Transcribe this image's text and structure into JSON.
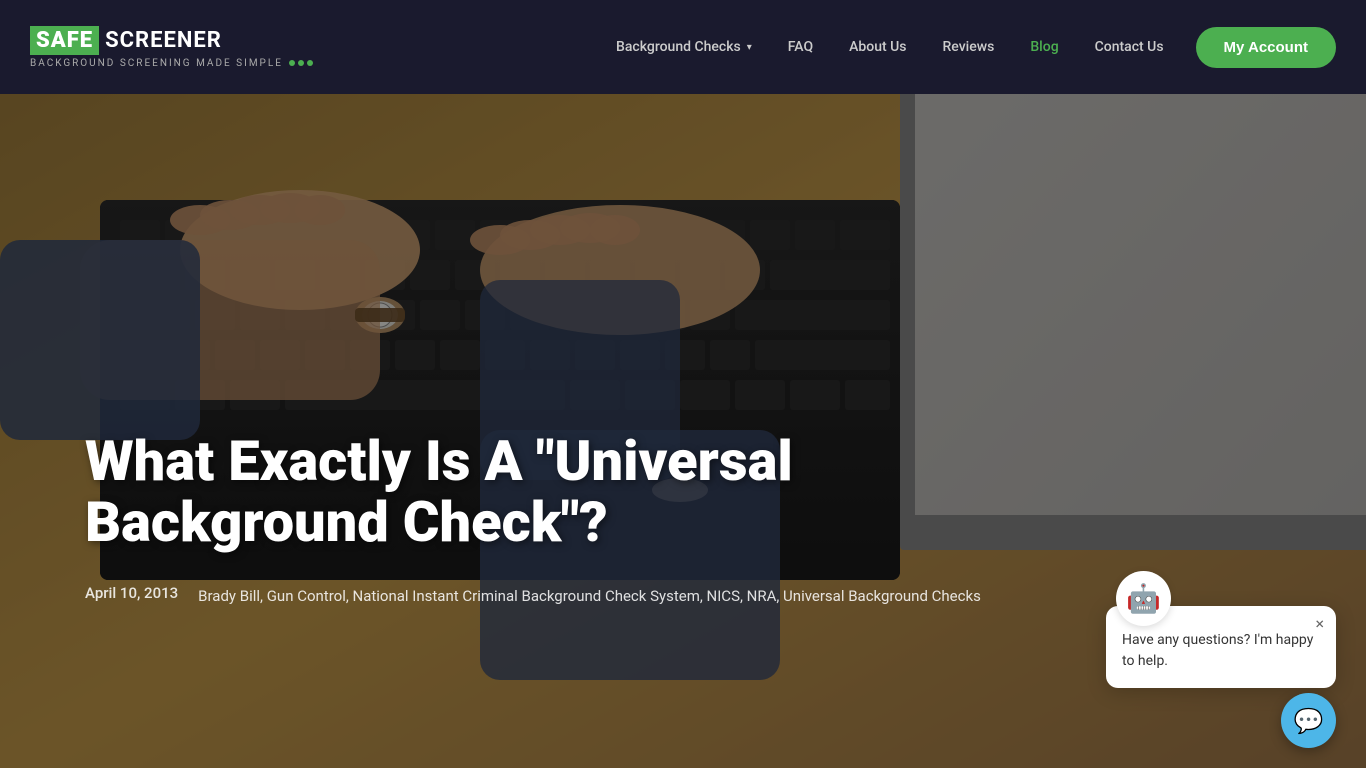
{
  "header": {
    "logo": {
      "safe": "SAFE",
      "screener": "SCREENER",
      "tagline": "BACKGROUND SCREENING MADE SIMPLE"
    },
    "nav": {
      "items": [
        {
          "label": "Background Checks",
          "hasDropdown": true,
          "active": false,
          "id": "background-checks"
        },
        {
          "label": "FAQ",
          "hasDropdown": false,
          "active": false,
          "id": "faq"
        },
        {
          "label": "About Us",
          "hasDropdown": false,
          "active": false,
          "id": "about-us"
        },
        {
          "label": "Reviews",
          "hasDropdown": false,
          "active": false,
          "id": "reviews"
        },
        {
          "label": "Blog",
          "hasDropdown": false,
          "active": true,
          "id": "blog"
        },
        {
          "label": "Contact Us",
          "hasDropdown": false,
          "active": false,
          "id": "contact-us"
        }
      ],
      "my_account_label": "My Account"
    }
  },
  "hero": {
    "title": "What Exactly Is A \"Universal Background Check\"?",
    "date": "April 10, 2013",
    "tags": "Brady Bill, Gun Control, National Instant Criminal Background Check System, NICS, NRA, Universal Background Checks"
  },
  "chat": {
    "message": "Have any questions? I'm happy to help.",
    "close_label": "×"
  }
}
